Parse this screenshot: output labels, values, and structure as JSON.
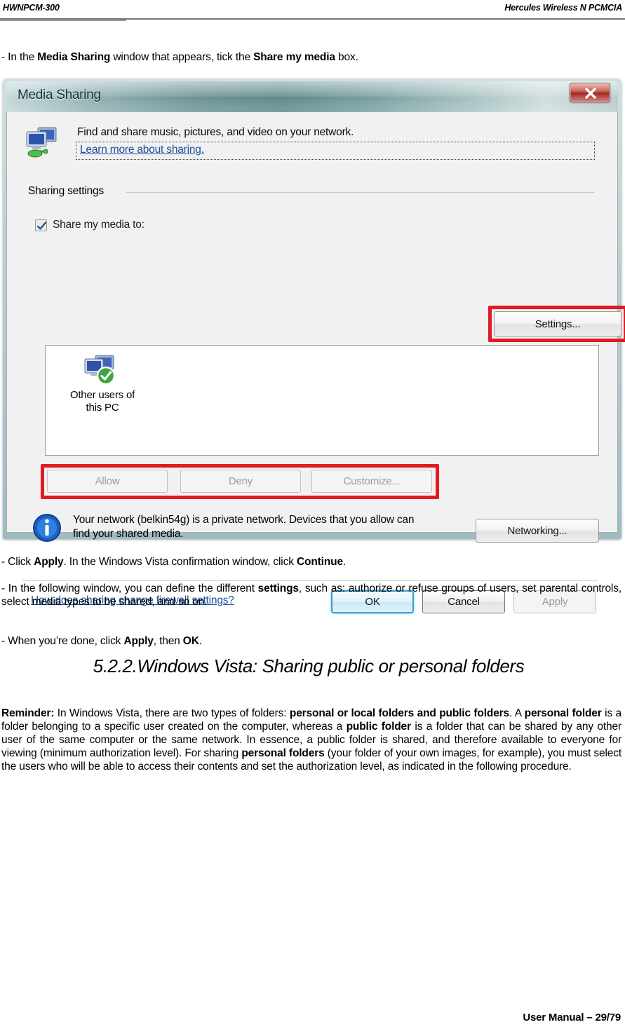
{
  "header": {
    "left": "HWNPCM-300",
    "right": "Hercules Wireless N PCMCIA"
  },
  "footer": {
    "text": "User Manual – 29/79"
  },
  "steps": {
    "step1_pre": "- In the ",
    "step1_b1": "Media Sharing",
    "step1_mid": " window that appears, tick the ",
    "step1_b2": "Share my media",
    "step1_end": " box.",
    "step2_pre": "- Click ",
    "step2_b1": "Apply",
    "step2_mid": ".  In the Windows Vista confirmation window, click ",
    "step2_b2": "Continue",
    "step2_end": ".",
    "step3_pre": "- In the following window, you can define the different ",
    "step3_b1": "settings",
    "step3_end": ", such as: authorize or refuse groups of users, set parental controls, select media types to be shared, and so on.",
    "step4_pre": "- When you’re done, click ",
    "step4_b1": "Apply",
    "step4_mid": ", then ",
    "step4_b2": "OK",
    "step4_end": "."
  },
  "heading": {
    "text": "5.2.2.Windows Vista: Sharing public or personal folders"
  },
  "reminder": {
    "label": "Reminder:",
    "t1": " In Windows Vista, there are two types of folders: ",
    "b1": "personal or local folders and public folders",
    "t2": ". A ",
    "b2": "personal folder",
    "t3": " is a folder belonging to a specific user created on the computer, whereas a ",
    "b3": "public folder",
    "t4": " is a folder that can be shared by any other user of the same computer or the same network.  In essence, a public folder is shared, and therefore available to everyone for viewing (minimum authorization level).  For sharing ",
    "b4": "personal folders",
    "t5": " (your folder of your own images, for example), you must select the users who will be able to access their contents and set the authorization level, as indicated in the following procedure."
  },
  "dialog": {
    "title": "Media Sharing",
    "close_label": "x",
    "intro_text": "Find and share music, pictures, and video on your network.",
    "learn_link": "Learn more about sharing.",
    "group_legend": "Sharing settings",
    "share_checkbox_label": "Share my media to:",
    "share_checkbox_checked": true,
    "settings_button": "Settings...",
    "list_items": [
      {
        "label_line1": "Other users of",
        "label_line2": "this PC",
        "status": "allowed"
      }
    ],
    "permission_buttons": [
      {
        "label": "Allow",
        "enabled": false
      },
      {
        "label": "Deny",
        "enabled": false
      },
      {
        "label": "Customize...",
        "enabled": false
      }
    ],
    "network_info_line1": "Your network (belkin54g) is a private network. Devices that you allow can",
    "network_info_line2": "find your shared media.",
    "networking_button": "Networking...",
    "firewall_link": "How does sharing change firewall settings?",
    "ok_button": "OK",
    "cancel_button": "Cancel",
    "apply_button": "Apply",
    "apply_enabled": false,
    "highlight_color": "#e01b22"
  }
}
